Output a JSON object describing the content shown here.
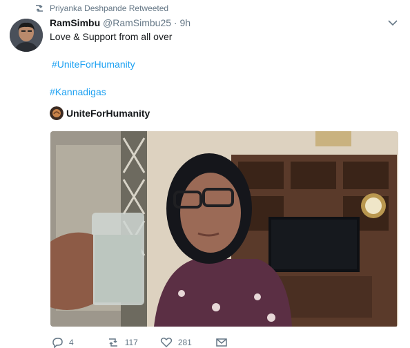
{
  "retweet": {
    "text": "Priyanka Deshpande Retweeted",
    "icon": "retweet-icon"
  },
  "author": {
    "name": "RamSimbu",
    "handle": "@RamSimbu25",
    "separator": " · ",
    "time": "9h"
  },
  "tweet": {
    "text": "Love & Support from all over",
    "hashtags": [
      "#UniteForHumanity",
      "#Kannadigas"
    ]
  },
  "card": {
    "title": "UniteForHumanity"
  },
  "actions": {
    "reply_count": "4",
    "retweet_count": "117",
    "like_count": "281"
  },
  "colors": {
    "link": "#1da1f2",
    "muted": "#657786",
    "text": "#14171a"
  }
}
